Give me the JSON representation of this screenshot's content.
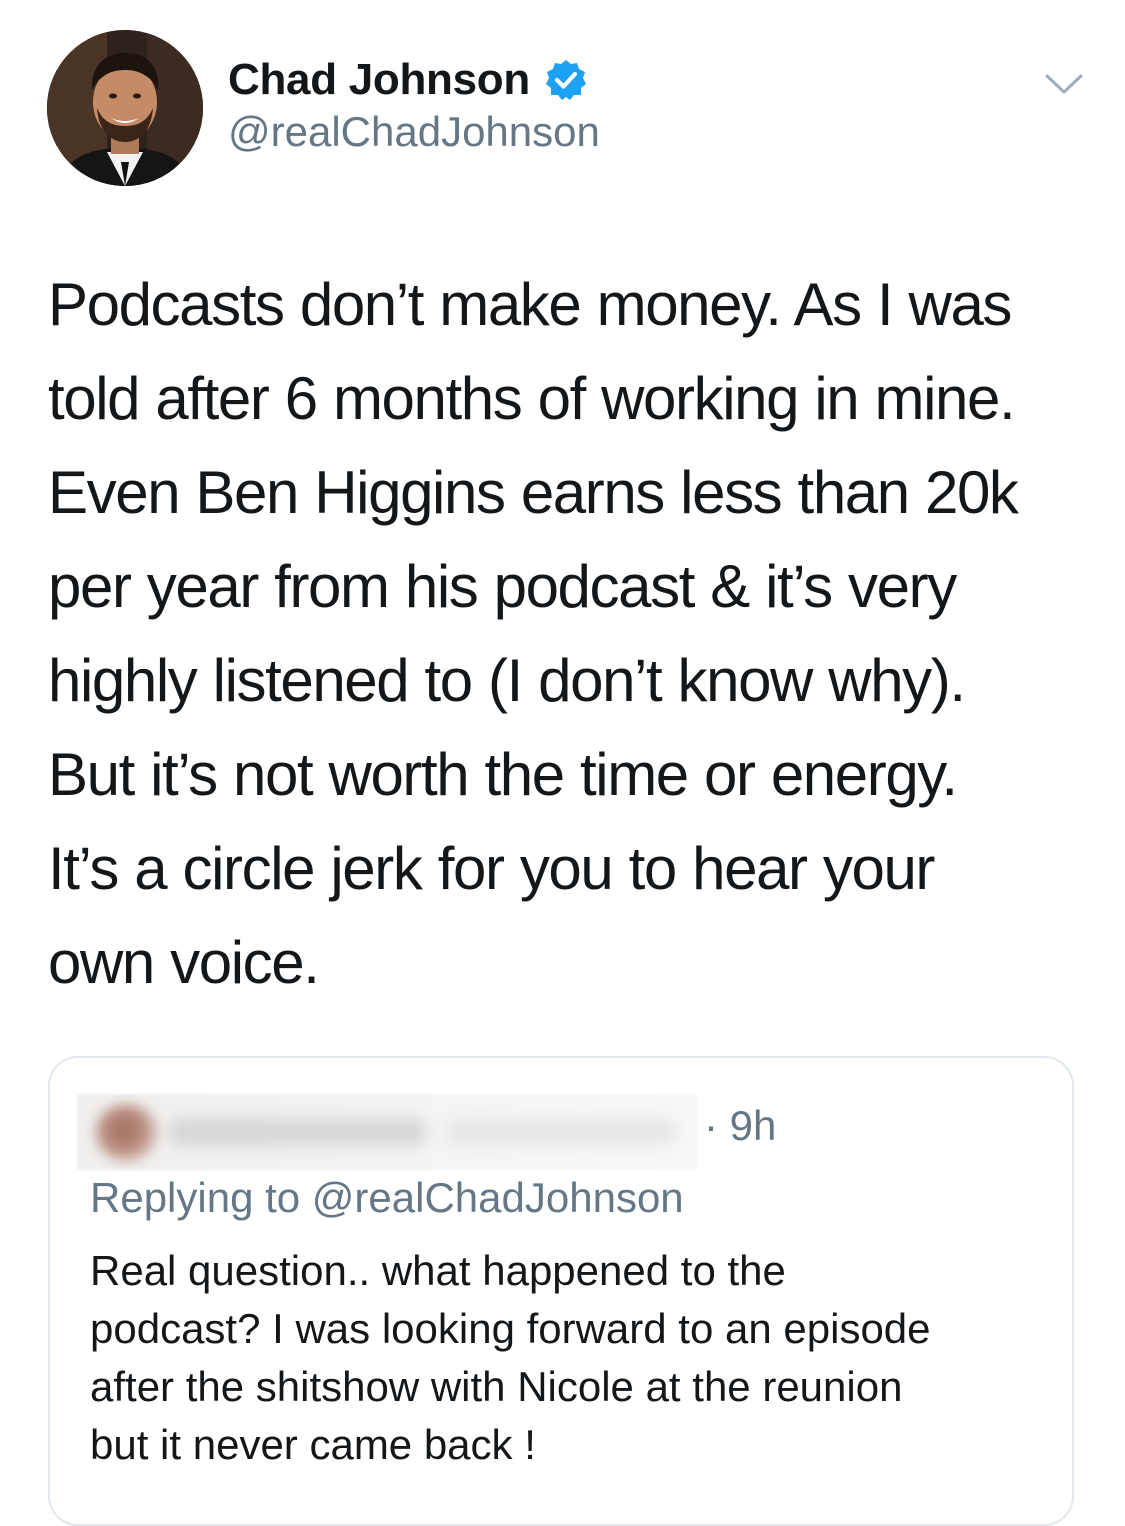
{
  "tweet": {
    "author": {
      "display_name": "Chad Johnson",
      "handle": "@realChadJohnson",
      "verified": true
    },
    "text_lines": [
      "Podcasts don’t make money. As I was",
      "told after 6 months of working in mine.",
      "Even Ben Higgins earns less than 20k",
      "per year from his podcast & it’s very",
      "highly listened to (I don’t know why).",
      "But it’s not worth the time or energy.",
      "It’s a circle jerk for you to hear your",
      "own voice."
    ]
  },
  "quoted_tweet": {
    "time": "· 9h",
    "replying_to": "Replying to @realChadJohnson",
    "text_lines": [
      "Real question.. what happened to the",
      "podcast? I was looking forward to an episode",
      "after the shitshow with Nicole at the reunion",
      "but it never came back !"
    ]
  },
  "icons": {
    "verified": "verified-badge-icon",
    "caret": "chevron-down-icon"
  },
  "colors": {
    "verified_blue": "#1da1f2",
    "secondary_text": "#657786",
    "primary_text": "#14171a",
    "border": "#e1e8ed"
  }
}
